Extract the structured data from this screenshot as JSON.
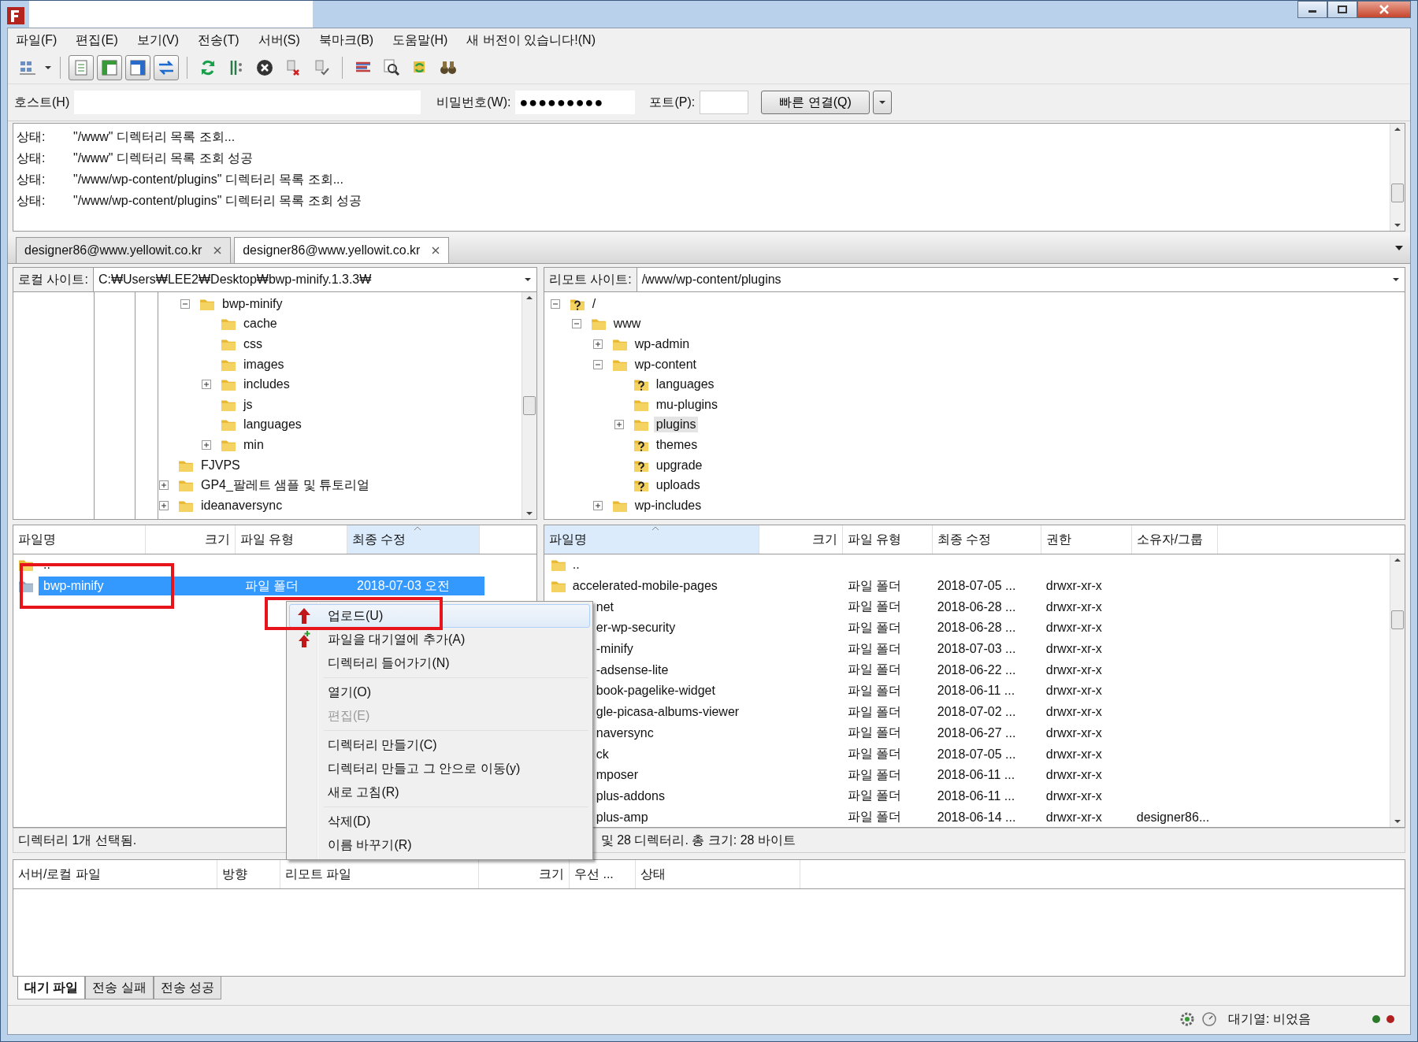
{
  "menu": [
    "파일(F)",
    "편집(E)",
    "보기(V)",
    "전송(T)",
    "서버(S)",
    "북마크(B)",
    "도움말(H)",
    "새 버전이 있습니다!(N)"
  ],
  "quickconnect": {
    "host_label": "호스트(H)",
    "password_label": "비밀번호(W):",
    "password": "●●●●●●●●●",
    "port_label": "포트(P):",
    "connect_button": "빠른 연결(Q)"
  },
  "log": [
    {
      "label": "상태:",
      "message": "\"/www\" 디렉터리 목록 조회..."
    },
    {
      "label": "상태:",
      "message": "\"/www\" 디렉터리 목록 조회 성공"
    },
    {
      "label": "상태:",
      "message": "\"/www/wp-content/plugins\" 디렉터리 목록 조회..."
    },
    {
      "label": "상태:",
      "message": "\"/www/wp-content/plugins\" 디렉터리 목록 조회 성공"
    }
  ],
  "tabs": [
    {
      "label": "designer86@www.yellowit.co.kr",
      "selected": false
    },
    {
      "label": "designer86@www.yellowit.co.kr",
      "selected": true
    }
  ],
  "local": {
    "label": "로컬 사이트:",
    "path": "C:₩Users₩LEE2₩Desktop₩bwp-minify.1.3.3₩",
    "tree": [
      {
        "children": [
          {
            "name": "bwp-minify",
            "kind": "folder",
            "expanded": true,
            "children": [
              {
                "name": "cache",
                "kind": "folder"
              },
              {
                "name": "css",
                "kind": "folder"
              },
              {
                "name": "images",
                "kind": "folder"
              },
              {
                "name": "includes",
                "kind": "folder",
                "expanded": false
              },
              {
                "name": "js",
                "kind": "folder"
              },
              {
                "name": "languages",
                "kind": "folder"
              },
              {
                "name": "min",
                "kind": "folder",
                "expanded": false
              }
            ]
          }
        ]
      },
      {
        "name": "FJVPS",
        "kind": "folder"
      },
      {
        "name": "GP4_팔레트 샘플 및 튜토리얼",
        "kind": "folder",
        "expanded": false
      },
      {
        "name": "ideanaversync",
        "kind": "folder",
        "expanded": false
      }
    ],
    "columns": [
      {
        "label": "파일명",
        "sorted": false
      },
      {
        "label": "크기",
        "sorted": false
      },
      {
        "label": "파일 유형",
        "sorted": false
      },
      {
        "label": "최종 수정",
        "sorted": true
      }
    ],
    "rows": [
      {
        "name": "..",
        "selected": false,
        "highlighted": false
      },
      {
        "name": "bwp-minify",
        "type": "파일 폴더",
        "modified": "2018-07-03 오전",
        "selected": true,
        "highlighted": true
      }
    ],
    "status": "디렉터리 1개 선택됨."
  },
  "remote": {
    "label": "리모트 사이트:",
    "path": "/www/wp-content/plugins",
    "tree": [
      {
        "name": "/",
        "kind": "unknown",
        "expanded": true,
        "selected": false,
        "children": [
          {
            "name": "www",
            "kind": "folder",
            "expanded": true,
            "selected": false,
            "children": [
              {
                "name": "wp-admin",
                "kind": "folder",
                "expanded": false,
                "selected": false
              },
              {
                "name": "wp-content",
                "kind": "folder",
                "expanded": true,
                "selected": false,
                "children": [
                  {
                    "name": "languages",
                    "kind": "unknown",
                    "selected": false
                  },
                  {
                    "name": "mu-plugins",
                    "kind": "folder",
                    "selected": false
                  },
                  {
                    "name": "plugins",
                    "kind": "folder",
                    "expanded": false,
                    "selected": true
                  },
                  {
                    "name": "themes",
                    "kind": "unknown",
                    "selected": false
                  },
                  {
                    "name": "upgrade",
                    "kind": "unknown",
                    "selected": false
                  },
                  {
                    "name": "uploads",
                    "kind": "unknown",
                    "selected": false
                  }
                ]
              },
              {
                "name": "wp-includes",
                "kind": "folder",
                "expanded": false,
                "selected": false
              }
            ]
          }
        ]
      }
    ],
    "columns": [
      {
        "label": "파일명",
        "sorted": true
      },
      {
        "label": "크기",
        "sorted": false
      },
      {
        "label": "파일 유형",
        "sorted": false
      },
      {
        "label": "최종 수정",
        "sorted": false
      },
      {
        "label": "권한",
        "sorted": false
      },
      {
        "label": "소유자/그룹",
        "sorted": false
      }
    ],
    "rows": [
      {
        "name": "..",
        "clipped": false
      },
      {
        "name": "accelerated-mobile-pages",
        "type": "파일 폴더",
        "modified": "2018-07-05 ...",
        "permissions": "drwxr-xr-x",
        "clipped": false
      },
      {
        "name": "net",
        "type": "파일 폴더",
        "modified": "2018-06-28 ...",
        "permissions": "drwxr-xr-x",
        "clipped": true
      },
      {
        "name": "er-wp-security",
        "type": "파일 폴더",
        "modified": "2018-06-28 ...",
        "permissions": "drwxr-xr-x",
        "clipped": true
      },
      {
        "name": "-minify",
        "type": "파일 폴더",
        "modified": "2018-07-03 ...",
        "permissions": "drwxr-xr-x",
        "clipped": true
      },
      {
        "name": "-adsense-lite",
        "type": "파일 폴더",
        "modified": "2018-06-22 ...",
        "permissions": "drwxr-xr-x",
        "clipped": true
      },
      {
        "name": "book-pagelike-widget",
        "type": "파일 폴더",
        "modified": "2018-06-11 ...",
        "permissions": "drwxr-xr-x",
        "clipped": true
      },
      {
        "name": "gle-picasa-albums-viewer",
        "type": "파일 폴더",
        "modified": "2018-07-02 ...",
        "permissions": "drwxr-xr-x",
        "clipped": true
      },
      {
        "name": "naversync",
        "type": "파일 폴더",
        "modified": "2018-06-27 ...",
        "permissions": "drwxr-xr-x",
        "clipped": true
      },
      {
        "name": "ck",
        "type": "파일 폴더",
        "modified": "2018-07-05 ...",
        "permissions": "drwxr-xr-x",
        "clipped": true
      },
      {
        "name": "mposer",
        "type": "파일 폴더",
        "modified": "2018-06-11 ...",
        "permissions": "drwxr-xr-x",
        "clipped": true
      },
      {
        "name": "plus-addons",
        "type": "파일 폴더",
        "modified": "2018-06-11 ...",
        "permissions": "drwxr-xr-x",
        "clipped": true
      },
      {
        "name": "plus-amp",
        "type": "파일 폴더",
        "modified": "2018-06-14 ...",
        "permissions": "drwxr-xr-x",
        "owner": "designer86...",
        "clipped": true
      }
    ],
    "status": "및 28 디렉터리. 총 크기: 28 바이트"
  },
  "context_menu": [
    {
      "kind": "item",
      "label": "업로드(U)",
      "selected": true,
      "disabled": false,
      "highlighted": true
    },
    {
      "kind": "item",
      "label": "파일을 대기열에 추가(A)",
      "selected": false,
      "disabled": false,
      "highlighted": false
    },
    {
      "kind": "item",
      "label": "디렉터리 들어가기(N)",
      "selected": false,
      "disabled": false,
      "highlighted": false
    },
    {
      "kind": "separator"
    },
    {
      "kind": "item",
      "label": "열기(O)",
      "selected": false,
      "disabled": false,
      "highlighted": false
    },
    {
      "kind": "item",
      "label": "편집(E)",
      "selected": false,
      "disabled": true,
      "highlighted": false
    },
    {
      "kind": "separator"
    },
    {
      "kind": "item",
      "label": "디렉터리 만들기(C)",
      "selected": false,
      "disabled": false,
      "highlighted": false
    },
    {
      "kind": "item",
      "label": "디렉터리 만들고 그 안으로 이동(y)",
      "selected": false,
      "disabled": false,
      "highlighted": false
    },
    {
      "kind": "item",
      "label": "새로 고침(R)",
      "selected": false,
      "disabled": false,
      "highlighted": false
    },
    {
      "kind": "separator"
    },
    {
      "kind": "item",
      "label": "삭제(D)",
      "selected": false,
      "disabled": false,
      "highlighted": false
    },
    {
      "kind": "item",
      "label": "이름 바꾸기(R)",
      "selected": false,
      "disabled": false,
      "highlighted": false
    }
  ],
  "queue": {
    "columns": [
      "서버/로컬 파일",
      "방향",
      "리모트 파일",
      "크기",
      "우선 ...",
      "상태"
    ],
    "tabs": [
      {
        "label": "대기 파일",
        "selected": true
      },
      {
        "label": "전송 실패",
        "selected": false
      },
      {
        "label": "전송 성공",
        "selected": false
      }
    ]
  },
  "status_bar": {
    "queue_text": "대기열: 비었음"
  }
}
